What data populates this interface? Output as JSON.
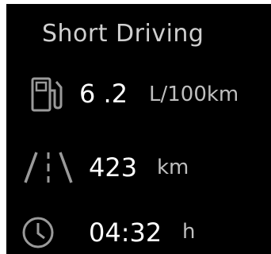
{
  "title": "Short Driving",
  "stats": [
    {
      "icon": "fuel-pump-icon",
      "value": "6 .2",
      "unit": "L/100km"
    },
    {
      "icon": "road-icon",
      "value": "423",
      "unit": "km"
    },
    {
      "icon": "clock-icon",
      "value": "04:32",
      "unit": "h"
    }
  ],
  "colors": {
    "background": "#000000",
    "value": "#ffffff",
    "unit": "#bfbfbf",
    "icon": "#9a9a9a"
  }
}
